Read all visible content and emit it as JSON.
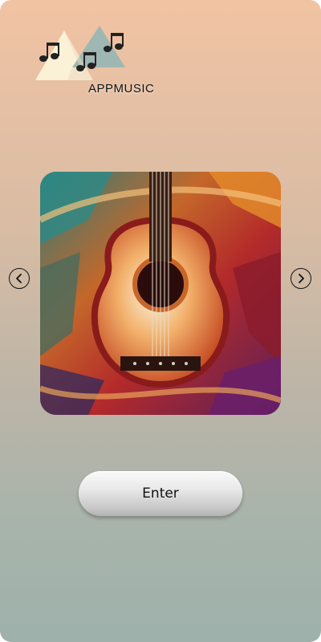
{
  "app": {
    "brand_name": "APPMUSIC",
    "logo_icon": "music-notes-triangles-logo"
  },
  "carousel": {
    "image_alt": "abstract-painted-acoustic-guitar",
    "prev_icon": "chevron-left-icon",
    "next_icon": "chevron-right-icon"
  },
  "actions": {
    "enter_label": "Enter"
  },
  "colors": {
    "gradient_top": "#f1c3a3",
    "gradient_bottom": "#9eb1ab",
    "button_bg": "#e2e2e2",
    "text": "#111111"
  }
}
